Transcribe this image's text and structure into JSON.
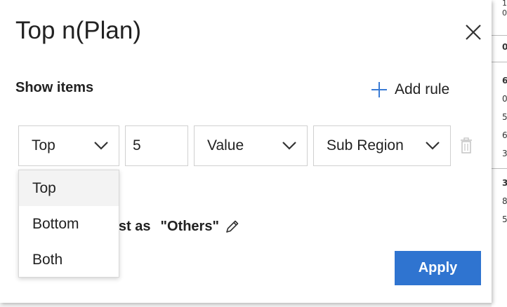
{
  "background_sheet": {
    "cells": [
      "1",
      "0",
      "0",
      "6",
      "0",
      "5",
      "6",
      "3",
      "3",
      "8",
      "5"
    ]
  },
  "dialog": {
    "title": "Top n(Plan)",
    "close_icon": "close-icon",
    "show_items_label": "Show items",
    "add_rule_label": "Add rule",
    "add_rule_icon": "plus-icon",
    "rule": {
      "direction_value": "Top",
      "count_value": "5",
      "by_value": "Value",
      "field_value": "Sub Region",
      "delete_icon": "trash-icon"
    },
    "rest_label": "rest as",
    "others_label": "\"Others\"",
    "edit_icon": "pencil-icon",
    "apply_label": "Apply"
  },
  "dropdown": {
    "options": [
      "Top",
      "Bottom",
      "Both"
    ],
    "selected": "Top"
  },
  "colors": {
    "accent": "#2f74d0",
    "plus_icon": "#3a7bd5",
    "border": "#d0d0d0",
    "hover_bg": "#f3f3f3"
  }
}
